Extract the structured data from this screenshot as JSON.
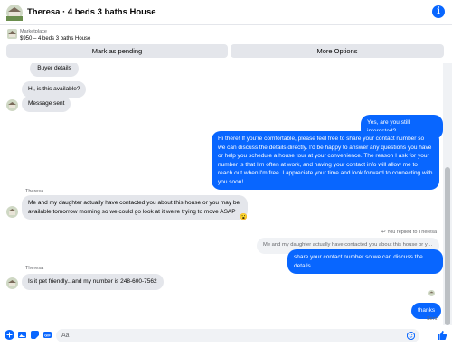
{
  "header": {
    "title": "Theresa · 4 beds 3 baths House",
    "info_icon": "info-icon"
  },
  "listing": {
    "source": "Marketplace",
    "summary": "$950 – 4 beds 3 baths House"
  },
  "actions": {
    "mark_pending": "Mark as pending",
    "more_options": "More Options"
  },
  "thread": {
    "buyer_details_label": "Buyer details",
    "msg_available": "Hi, is this available?",
    "msg_sent": "Message sent",
    "msg_still_interested": "Yes, are you still interested?",
    "msg_long": "Hi there! If you're comfortable, please feel free to share your contact number so we can discuss the details directly. I'd be happy to answer any questions you have or help you schedule a house tour at your convenience. The reason I ask for your number is that I'm often at work, and having your contact info will allow me to reach out when I'm free. I appreciate your time and look forward to connecting with you soon!",
    "sender_name_1": "Theresa",
    "msg_daughter": "Me and my daughter actually have contacted you about this house or you may be available tomorrow morning so we could go look at it we're trying to move ASAP",
    "reaction_emoji": "😮",
    "replied_to": "You replied to Theresa",
    "quoted_text": "Me and my daughter actually have contacted you about this house or you may be...",
    "msg_share_number": "share your contact number so we can discuss the details",
    "sender_name_2": "Theresa",
    "msg_pet": "Is it pet friendly...and my number is 248-600-7562",
    "msg_thanks": "thanks",
    "sent_status": "Sent"
  },
  "composer": {
    "placeholder": "Aa"
  },
  "colors": {
    "accent": "#0866ff",
    "incoming": "#e4e6eb",
    "muted": "#65676b"
  }
}
